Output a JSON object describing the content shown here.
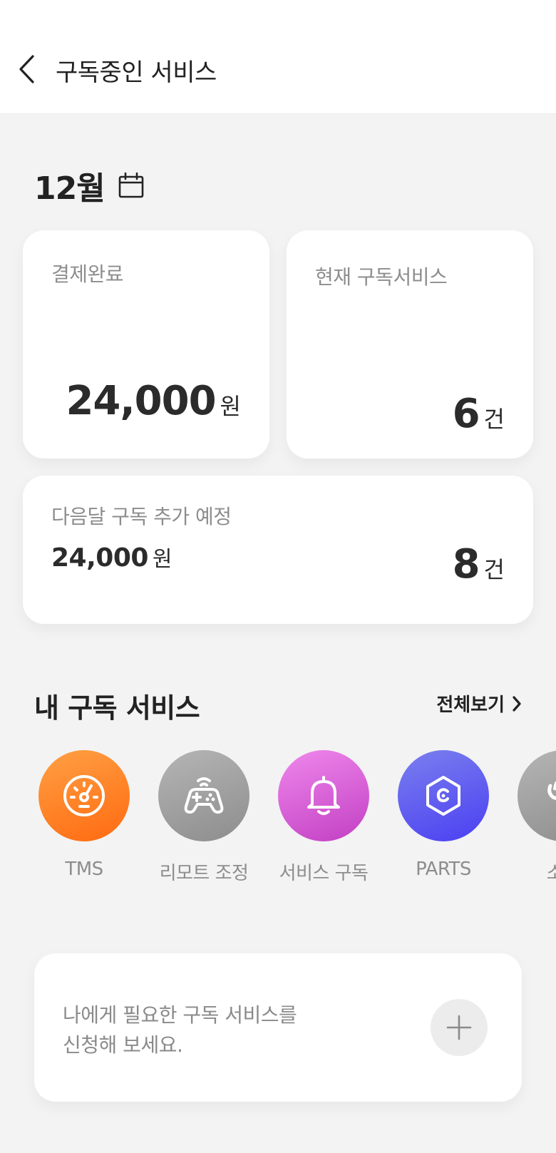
{
  "header": {
    "title": "구독중인 서비스",
    "back_icon": "chevron-left-icon"
  },
  "month": {
    "label": "12월",
    "calendar_icon": "calendar-icon"
  },
  "paid_card": {
    "label": "결제완료",
    "amount": "24,000",
    "unit": "원"
  },
  "current_card": {
    "label": "현재 구독서비스",
    "count": "6",
    "unit": "건"
  },
  "next_card": {
    "label": "다음달 구독 추가 예정",
    "amount": "24,000",
    "amount_unit": "원",
    "count": "8",
    "count_unit": "건"
  },
  "my_services": {
    "title": "내 구독 서비스",
    "view_all": "전체보기",
    "items": [
      {
        "label": "TMS",
        "icon": "gauge-icon",
        "color": "#ff7a1a"
      },
      {
        "label": "리모트 조정",
        "icon": "gamepad-icon",
        "color": "#9e9e9e"
      },
      {
        "label": "서비스 구독",
        "icon": "bell-icon",
        "color": "#d95fd6"
      },
      {
        "label": "PARTS",
        "icon": "hexagon-icon",
        "color": "#5a5cf0"
      },
      {
        "label": "소모",
        "icon": "wrench-icon",
        "color": "#9e9e9e"
      }
    ]
  },
  "apply_card": {
    "line1": "나에게 필요한 구독 서비스를",
    "line2": "신청해 보세요.",
    "plus_icon": "plus-icon"
  }
}
